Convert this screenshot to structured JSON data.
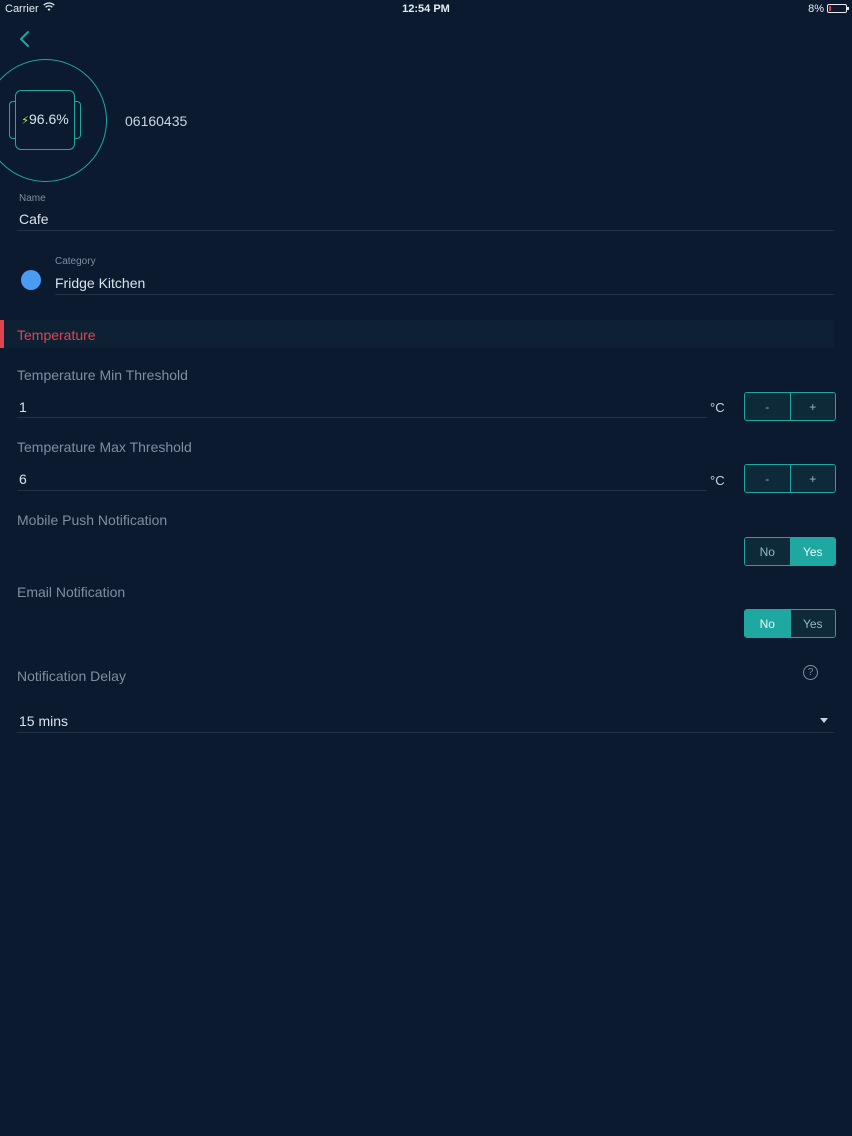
{
  "status_bar": {
    "carrier": "Carrier",
    "time": "12:54 PM",
    "battery_percent": "8%",
    "battery_color": "#e53945"
  },
  "header": {
    "back_icon": "chevron-left-icon",
    "accent_color": "#1fa8a2"
  },
  "device": {
    "battery_level": "96.6%",
    "charging_icon": "bolt-icon",
    "id": "06160435"
  },
  "name_field": {
    "label": "Name",
    "value": "Cafe"
  },
  "category_field": {
    "label": "Category",
    "value": "Fridge Kitchen",
    "dot_color": "#4a9cf2"
  },
  "section": {
    "title": "Temperature",
    "accent_color": "#e1444f"
  },
  "min_threshold": {
    "label": "Temperature Min Threshold",
    "value": "1",
    "unit": "°C",
    "minus": "-",
    "plus": "+"
  },
  "max_threshold": {
    "label": "Temperature Max Threshold",
    "value": "6",
    "unit": "°C",
    "minus": "-",
    "plus": "+"
  },
  "push_notification": {
    "label": "Mobile Push Notification",
    "no": "No",
    "yes": "Yes",
    "selected": "Yes"
  },
  "email_notification": {
    "label": "Email Notification",
    "no": "No",
    "yes": "Yes",
    "selected": "No"
  },
  "notification_delay": {
    "label": "Notification Delay",
    "help": "?",
    "value": "15 mins"
  }
}
